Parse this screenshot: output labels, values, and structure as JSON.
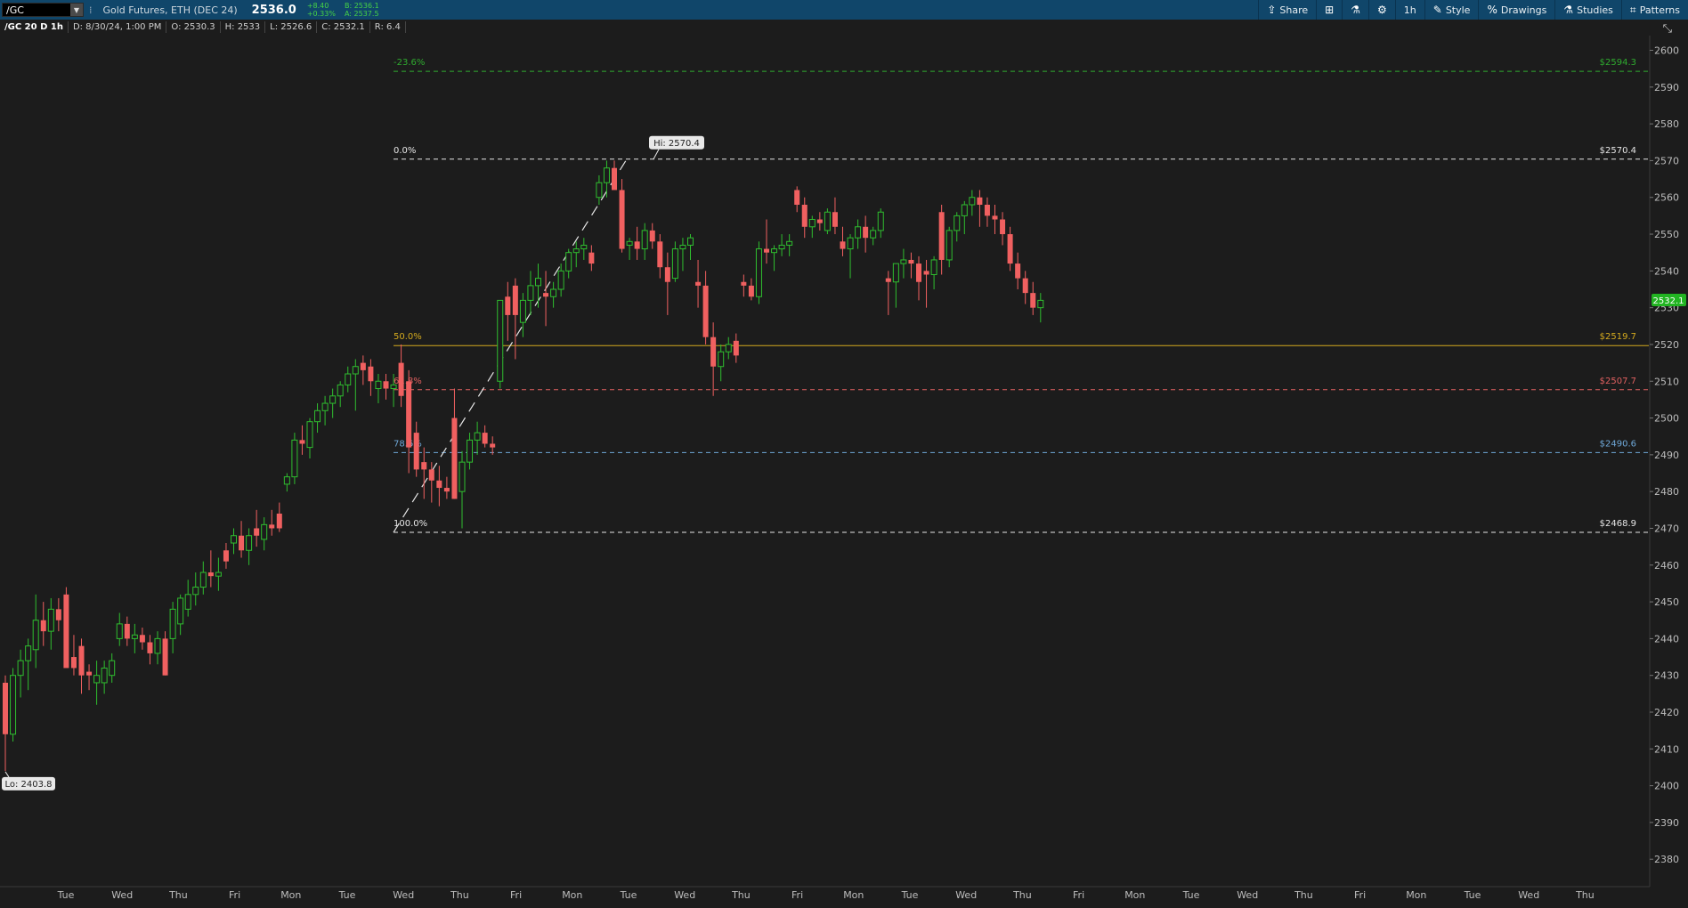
{
  "toolbar": {
    "symbol": "/GC",
    "description": "Gold Futures, ETH (DEC 24)",
    "last_price": "2536.0",
    "change": "+8.40",
    "change_pct": "+0.33%",
    "bid": "B: 2536.1",
    "ask": "A: 2537.5",
    "buttons": {
      "share": "Share",
      "interval": "1h",
      "style": "Style",
      "drawings": "Drawings",
      "studies": "Studies",
      "patterns": "Patterns"
    }
  },
  "infobar": {
    "symbol_period": "/GC 20 D 1h",
    "date": "D: 8/30/24, 1:00 PM",
    "open": "O: 2530.3",
    "high": "H: 2533",
    "low": "L: 2526.6",
    "close": "C: 2532.1",
    "range": "R: 6.4"
  },
  "colors": {
    "up": "#2fbe2f",
    "down": "#f06060",
    "toolbar": "#10466a",
    "background": "#1c1c1c"
  },
  "chart_data": {
    "type": "candlestick",
    "ylim": [
      2374,
      2604
    ],
    "y_ticks": [
      2380,
      2390,
      2400,
      2410,
      2420,
      2430,
      2440,
      2450,
      2460,
      2470,
      2480,
      2490,
      2500,
      2510,
      2520,
      2530,
      2540,
      2550,
      2560,
      2570,
      2580,
      2590,
      2600
    ],
    "x_labels": [
      "Tue",
      "Wed",
      "Thu",
      "Fri",
      "Mon",
      "Tue",
      "Wed",
      "Thu",
      "Fri",
      "Mon",
      "Tue",
      "Wed",
      "Thu",
      "Fri",
      "Mon",
      "Tue",
      "Wed",
      "Thu",
      "Fri",
      "Mon",
      "Tue",
      "Wed",
      "Thu",
      "Fri",
      "Mon",
      "Tue",
      "Wed",
      "Thu"
    ],
    "current_price_label": "2532.1",
    "high_label": "Hi: 2570.4",
    "low_label": "Lo: 2403.8",
    "fibonacci": [
      {
        "pct": "-23.6%",
        "price": 2594.3,
        "price_label": "$2594.3",
        "color": "#2faa2f",
        "style": "dashed"
      },
      {
        "pct": "0.0%",
        "price": 2570.4,
        "price_label": "$2570.4",
        "color": "#e6e6e6",
        "style": "dashed"
      },
      {
        "pct": "50.0%",
        "price": 2519.7,
        "price_label": "$2519.7",
        "color": "#d4aa1e",
        "style": "solid"
      },
      {
        "pct": "61.8%",
        "price": 2507.7,
        "price_label": "$2507.7",
        "color": "#e06060",
        "style": "dashed"
      },
      {
        "pct": "78.6%",
        "price": 2490.6,
        "price_label": "$2490.6",
        "color": "#6fa8d8",
        "style": "dashed"
      },
      {
        "pct": "100.0%",
        "price": 2468.9,
        "price_label": "$2468.9",
        "color": "#e6e6e6",
        "style": "dashed"
      }
    ],
    "candles": [
      [
        2428,
        2430,
        2404,
        2414
      ],
      [
        2414,
        2432,
        2412,
        2430
      ],
      [
        2430,
        2437,
        2424,
        2434
      ],
      [
        2434,
        2440,
        2426,
        2438
      ],
      [
        2437,
        2452,
        2432,
        2445
      ],
      [
        2445,
        2450,
        2438,
        2442
      ],
      [
        2442,
        2451,
        2437,
        2448
      ],
      [
        2448,
        2451,
        2442,
        2445
      ],
      [
        2452,
        2454,
        2434,
        2432
      ],
      [
        2435,
        2441,
        2430,
        2432
      ],
      [
        2438,
        2440,
        2425,
        2430
      ],
      [
        2431,
        2433,
        2426,
        2430
      ],
      [
        2428,
        2434,
        2422,
        2430
      ],
      [
        2428,
        2434,
        2425,
        2432
      ],
      [
        2430,
        2436,
        2428,
        2434
      ],
      [
        2440,
        2447,
        2438,
        2444
      ],
      [
        2444,
        2446,
        2438,
        2440
      ],
      [
        2440,
        2444,
        2436,
        2441
      ],
      [
        2441,
        2443,
        2437,
        2439
      ],
      [
        2439,
        2441,
        2433,
        2436
      ],
      [
        2436,
        2442,
        2433,
        2440
      ],
      [
        2440,
        2442,
        2430,
        2430
      ],
      [
        2440,
        2450,
        2436,
        2448
      ],
      [
        2444,
        2452,
        2441,
        2451
      ],
      [
        2448,
        2456,
        2446,
        2452
      ],
      [
        2452,
        2458,
        2449,
        2454
      ],
      [
        2454,
        2461,
        2452,
        2458
      ],
      [
        2458,
        2464,
        2454,
        2457
      ],
      [
        2457,
        2462,
        2453,
        2458
      ],
      [
        2464,
        2466,
        2459,
        2461
      ],
      [
        2466,
        2470,
        2463,
        2468
      ],
      [
        2468,
        2472,
        2462,
        2464
      ],
      [
        2464,
        2470,
        2460,
        2468
      ],
      [
        2470,
        2475,
        2465,
        2468
      ],
      [
        2467,
        2473,
        2464,
        2471
      ],
      [
        2471,
        2475,
        2468,
        2470
      ],
      [
        2474,
        2477,
        2469,
        2470
      ],
      [
        2482,
        2485,
        2480,
        2484
      ],
      [
        2484,
        2496,
        2482,
        2494
      ],
      [
        2494,
        2498,
        2490,
        2493
      ],
      [
        2492,
        2500,
        2489,
        2499
      ],
      [
        2499,
        2504,
        2496,
        2502
      ],
      [
        2502,
        2506,
        2498,
        2504
      ],
      [
        2504,
        2508,
        2500,
        2506
      ],
      [
        2506,
        2510,
        2503,
        2509
      ],
      [
        2509,
        2514,
        2507,
        2512
      ],
      [
        2512,
        2516,
        2502,
        2514
      ],
      [
        2515,
        2517,
        2509,
        2513
      ],
      [
        2514,
        2516,
        2506,
        2510
      ],
      [
        2508,
        2512,
        2504,
        2510
      ],
      [
        2510,
        2512,
        2505,
        2508
      ],
      [
        2508,
        2512,
        2503,
        2509
      ],
      [
        2515,
        2520,
        2503,
        2506
      ],
      [
        2510,
        2513,
        2485,
        2492
      ],
      [
        2496,
        2499,
        2484,
        2486
      ],
      [
        2488,
        2492,
        2478,
        2486
      ],
      [
        2486,
        2488,
        2477,
        2483
      ],
      [
        2483,
        2487,
        2476,
        2481
      ],
      [
        2481,
        2484,
        2478,
        2480
      ],
      [
        2500,
        2508,
        2478,
        2478
      ],
      [
        2480,
        2491,
        2470,
        2488
      ],
      [
        2488,
        2496,
        2486,
        2494
      ],
      [
        2494,
        2499,
        2490,
        2496
      ],
      [
        2496,
        2498,
        2492,
        2493
      ],
      [
        2493,
        2495,
        2490,
        2492
      ],
      [
        2510,
        2531,
        2508,
        2532
      ],
      [
        2533,
        2537,
        2521,
        2528
      ],
      [
        2536,
        2538,
        2516,
        2528
      ],
      [
        2526,
        2534,
        2522,
        2532
      ],
      [
        2532,
        2540,
        2528,
        2536
      ],
      [
        2536,
        2542,
        2530,
        2538
      ],
      [
        2534,
        2540,
        2525,
        2533
      ],
      [
        2533,
        2537,
        2530,
        2535
      ],
      [
        2535,
        2542,
        2533,
        2540
      ],
      [
        2540,
        2546,
        2538,
        2545
      ],
      [
        2545,
        2548,
        2541,
        2546
      ],
      [
        2546,
        2549,
        2543,
        2547
      ],
      [
        2545,
        2547,
        2540,
        2542
      ],
      [
        2560,
        2566,
        2558,
        2564
      ],
      [
        2564,
        2570,
        2560,
        2568
      ],
      [
        2568,
        2570,
        2564,
        2562
      ],
      [
        2562,
        2565,
        2545,
        2546
      ],
      [
        2547,
        2549,
        2543,
        2548
      ],
      [
        2548,
        2552,
        2543,
        2546
      ],
      [
        2546,
        2553,
        2543,
        2551
      ],
      [
        2551,
        2553,
        2546,
        2548
      ],
      [
        2548,
        2550,
        2538,
        2541
      ],
      [
        2541,
        2545,
        2528,
        2537
      ],
      [
        2538,
        2548,
        2537,
        2546
      ],
      [
        2546,
        2549,
        2540,
        2547
      ],
      [
        2547,
        2550,
        2543,
        2549
      ],
      [
        2537,
        2543,
        2530,
        2536
      ],
      [
        2536,
        2540,
        2520,
        2522
      ],
      [
        2522,
        2526,
        2506,
        2514
      ],
      [
        2514,
        2520,
        2510,
        2518
      ],
      [
        2518,
        2522,
        2516,
        2520
      ],
      [
        2521,
        2523,
        2515,
        2517
      ],
      [
        2537,
        2539,
        2533,
        2536
      ],
      [
        2536,
        2538,
        2532,
        2533
      ],
      [
        2533,
        2548,
        2531,
        2546
      ],
      [
        2546,
        2554,
        2542,
        2545
      ],
      [
        2545,
        2547,
        2540,
        2546
      ],
      [
        2546,
        2550,
        2544,
        2547
      ],
      [
        2547,
        2550,
        2544,
        2548
      ],
      [
        2562,
        2563,
        2556,
        2558
      ],
      [
        2558,
        2560,
        2549,
        2552
      ],
      [
        2552,
        2555,
        2549,
        2554
      ],
      [
        2554,
        2556,
        2551,
        2553
      ],
      [
        2551,
        2557,
        2550,
        2556
      ],
      [
        2556,
        2560,
        2550,
        2552
      ],
      [
        2548,
        2552,
        2544,
        2546
      ],
      [
        2546,
        2550,
        2538,
        2549
      ],
      [
        2549,
        2554,
        2546,
        2552
      ],
      [
        2552,
        2555,
        2545,
        2549
      ],
      [
        2549,
        2552,
        2547,
        2551
      ],
      [
        2551,
        2557,
        2549,
        2556
      ],
      [
        2538,
        2540,
        2528,
        2537
      ],
      [
        2537,
        2542,
        2530,
        2542
      ],
      [
        2542,
        2546,
        2538,
        2543
      ],
      [
        2543,
        2545,
        2538,
        2542
      ],
      [
        2542,
        2544,
        2532,
        2537
      ],
      [
        2540,
        2543,
        2530,
        2539
      ],
      [
        2539,
        2544,
        2535,
        2543
      ],
      [
        2556,
        2558,
        2539,
        2543
      ],
      [
        2543,
        2552,
        2541,
        2551
      ],
      [
        2551,
        2556,
        2548,
        2555
      ],
      [
        2555,
        2559,
        2550,
        2558
      ],
      [
        2558,
        2562,
        2555,
        2560
      ],
      [
        2560,
        2562,
        2552,
        2558
      ],
      [
        2558,
        2560,
        2552,
        2555
      ],
      [
        2555,
        2558,
        2550,
        2554
      ],
      [
        2554,
        2556,
        2547,
        2550
      ],
      [
        2550,
        2552,
        2540,
        2542
      ],
      [
        2542,
        2545,
        2535,
        2538
      ],
      [
        2538,
        2540,
        2531,
        2534
      ],
      [
        2534,
        2537,
        2528,
        2530
      ],
      [
        2530,
        2534,
        2526,
        2532
      ]
    ]
  }
}
